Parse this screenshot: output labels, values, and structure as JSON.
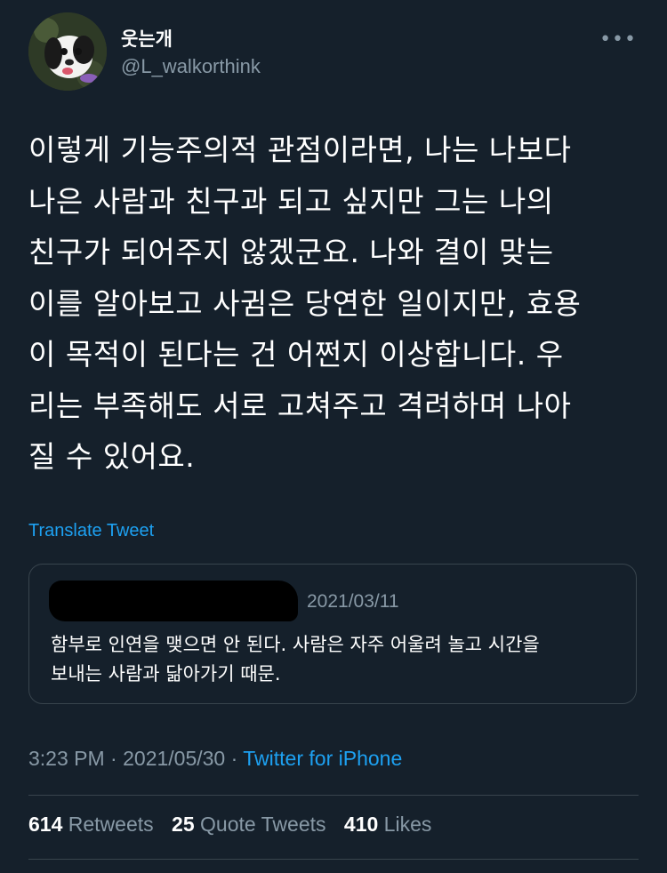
{
  "author": {
    "display_name": "웃는개",
    "handle": "@L_walkorthink"
  },
  "more_icon": "•••",
  "tweet": {
    "text": "이렇게 기능주의적 관점이라면, 나는 나보다\n나은 사람과 친구과 되고 싶지만 그는 나의\n친구가 되어주지 않겠군요. 나와 결이 맞는\n이를 알아보고 사귐은 당연한 일이지만, 효용\n이 목적이 된다는 건 어쩐지 이상합니다. 우\n리는 부족해도 서로 고쳐주고 격려하며 나아\n질 수 있어요."
  },
  "translate_label": "Translate Tweet",
  "quoted": {
    "date": "2021/03/11",
    "text": "함부로 인연을 맺으면 안 된다. 사람은 자주 어울려 놀고 시간을\n보내는 사람과 닮아가기 때문."
  },
  "meta": {
    "time": "3:23 PM",
    "separator": "·",
    "date": "2021/05/30",
    "source": "Twitter for iPhone"
  },
  "stats": {
    "retweets_count": "614",
    "retweets_label": "Retweets",
    "quotes_count": "25",
    "quotes_label": "Quote Tweets",
    "likes_count": "410",
    "likes_label": "Likes"
  }
}
